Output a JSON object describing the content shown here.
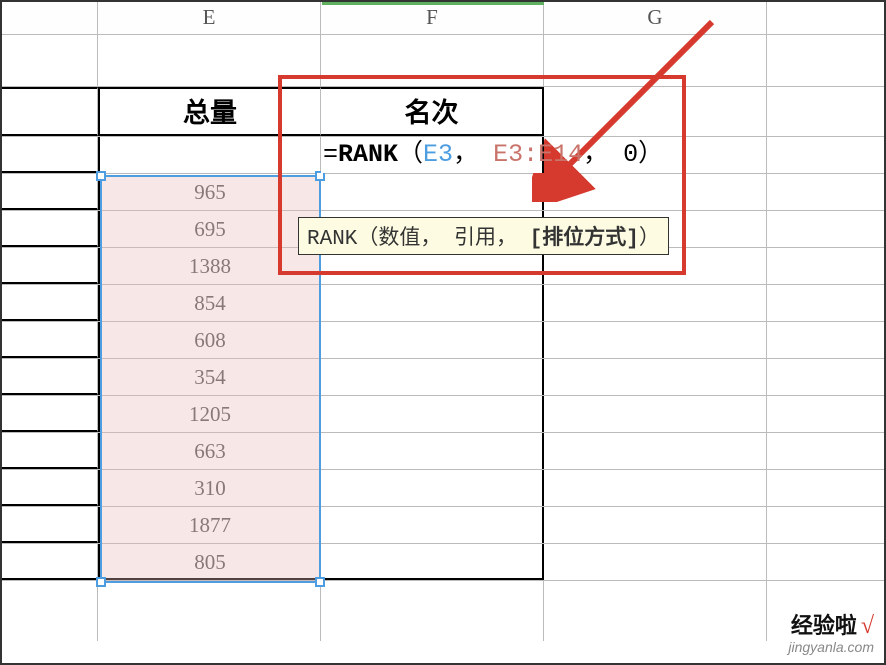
{
  "columns": {
    "E": "E",
    "F": "F",
    "G": "G"
  },
  "headers": {
    "col_e": "总量",
    "col_f": "名次"
  },
  "formula": {
    "prefix": "=",
    "fn": "RANK",
    "open": "（",
    "arg1": "E3",
    "sep1": "，",
    "arg2": "E3:E14",
    "sep2": "，",
    "arg3": "0",
    "close": "）"
  },
  "tooltip": {
    "fn": "RANK",
    "open": "（",
    "p1": "数值",
    "sep1": "，",
    "p2": "引用",
    "sep2": "，",
    "p3": "[排位方式]",
    "close": "）"
  },
  "data_e": [
    "965",
    "695",
    "1388",
    "854",
    "608",
    "354",
    "1205",
    "663",
    "310",
    "1877",
    "805"
  ],
  "watermark": {
    "text": "经验啦",
    "tick": "√",
    "url": "jingyanla.com"
  }
}
